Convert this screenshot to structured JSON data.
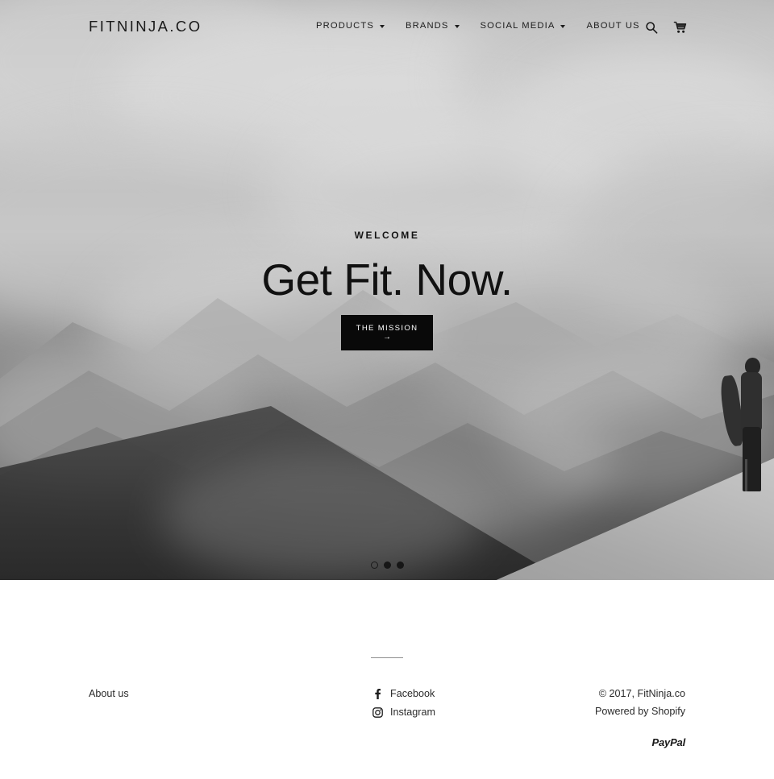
{
  "header": {
    "brand": "FITNINJA.CO",
    "nav": [
      {
        "label": "PRODUCTS",
        "has_dropdown": true
      },
      {
        "label": "BRANDS",
        "has_dropdown": true
      },
      {
        "label": "SOCIAL MEDIA",
        "has_dropdown": true
      },
      {
        "label": "ABOUT US",
        "has_dropdown": false
      }
    ],
    "icons": [
      {
        "name": "search-icon"
      },
      {
        "name": "cart-icon"
      }
    ]
  },
  "hero": {
    "eyebrow": "WELCOME",
    "title": "Get Fit. Now.",
    "cta_label": "THE MISSION",
    "cta_arrow": "→",
    "slider": {
      "dots": [
        {
          "state": "active"
        },
        {
          "state": "inactive"
        },
        {
          "state": "inactive"
        }
      ]
    },
    "background": {
      "description": "black-and-white photo of cloud-covered mountain range with a snowboarder silhouette on the right ridge",
      "accent_dark": "#090909",
      "accent_light": "#ffffff"
    }
  },
  "footer": {
    "links": [
      {
        "label": "About us"
      }
    ],
    "social": [
      {
        "label": "Facebook",
        "icon": "facebook-icon"
      },
      {
        "label": "Instagram",
        "icon": "instagram-icon"
      }
    ],
    "copyright": "© 2017, FitNinja.co",
    "powered_by_prefix": "Powered by ",
    "powered_by_link": "Shopify",
    "payment": {
      "label": "PayPal",
      "icon": "paypal-logo"
    }
  }
}
